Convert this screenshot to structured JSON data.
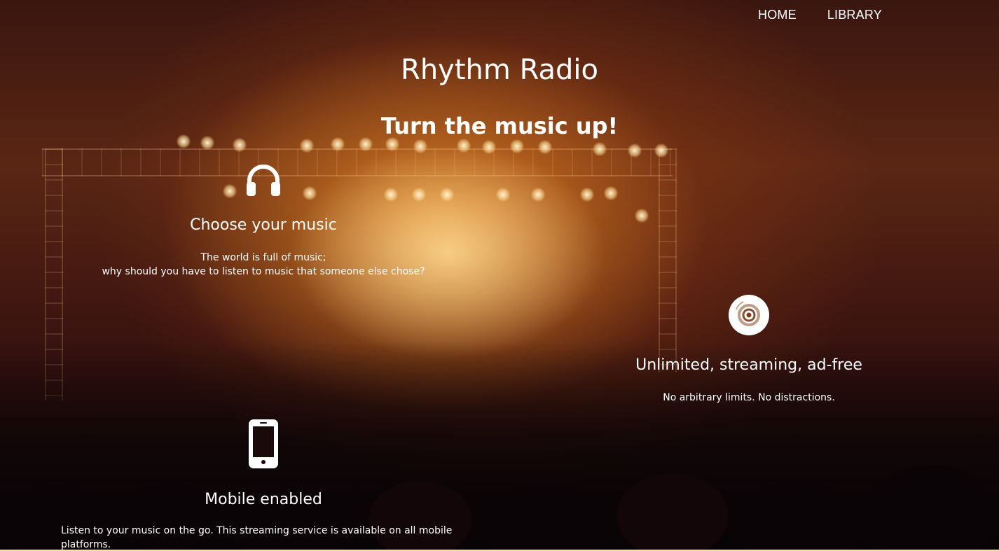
{
  "nav": {
    "items": [
      {
        "label": "HOME"
      },
      {
        "label": "LIBRARY"
      }
    ]
  },
  "hero": {
    "title": "Rhythm Radio",
    "tagline": "Turn the music up!"
  },
  "features": [
    {
      "icon": "headphones-icon",
      "heading": "Choose your music",
      "text_line1": "The world is full of music;",
      "text_line2": "why should you have to listen to music that someone else chose?"
    },
    {
      "icon": "disc-icon",
      "heading": "Unlimited, streaming, ad-free",
      "text_line1": "No arbitrary limits. No distractions."
    },
    {
      "icon": "mobile-phone-icon",
      "heading": "Mobile enabled",
      "text_line1": "Listen to your music on the go. This streaming service is available on all mobile platforms."
    }
  ],
  "colors": {
    "text": "#ffffff",
    "accent_warm": "#f0962a",
    "background_dark": "#0d0607"
  }
}
